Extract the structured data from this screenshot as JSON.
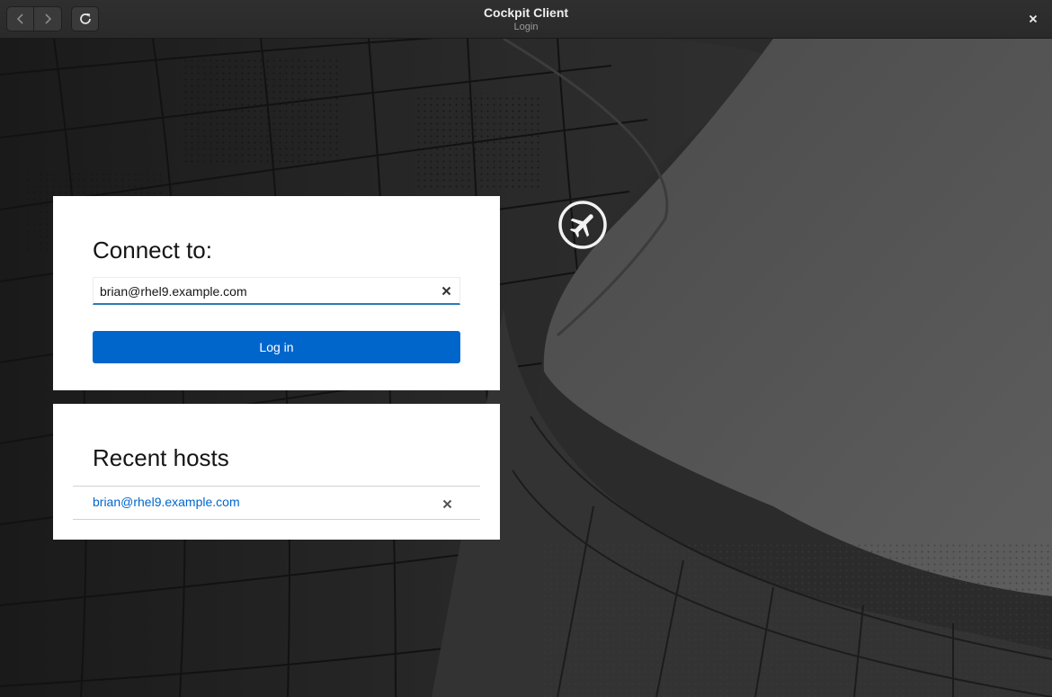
{
  "window": {
    "title": "Cockpit Client",
    "subtitle": "Login"
  },
  "toolbar": {
    "back_icon": "chevron-left-icon",
    "forward_icon": "chevron-right-icon",
    "reload_icon": "reload-icon",
    "close_icon": "close-icon"
  },
  "connect": {
    "heading": "Connect to:",
    "host_value": "brian@rhel9.example.com",
    "login_label": "Log in",
    "clear_icon": "close-icon"
  },
  "recent": {
    "heading": "Recent hosts",
    "hosts": [
      {
        "label": "brian@rhel9.example.com"
      }
    ]
  },
  "colors": {
    "accent": "#0066cc",
    "headerbar": "#2c2c2c",
    "input_underline": "#2b7bb9"
  },
  "logo": "cockpit-logo-icon"
}
